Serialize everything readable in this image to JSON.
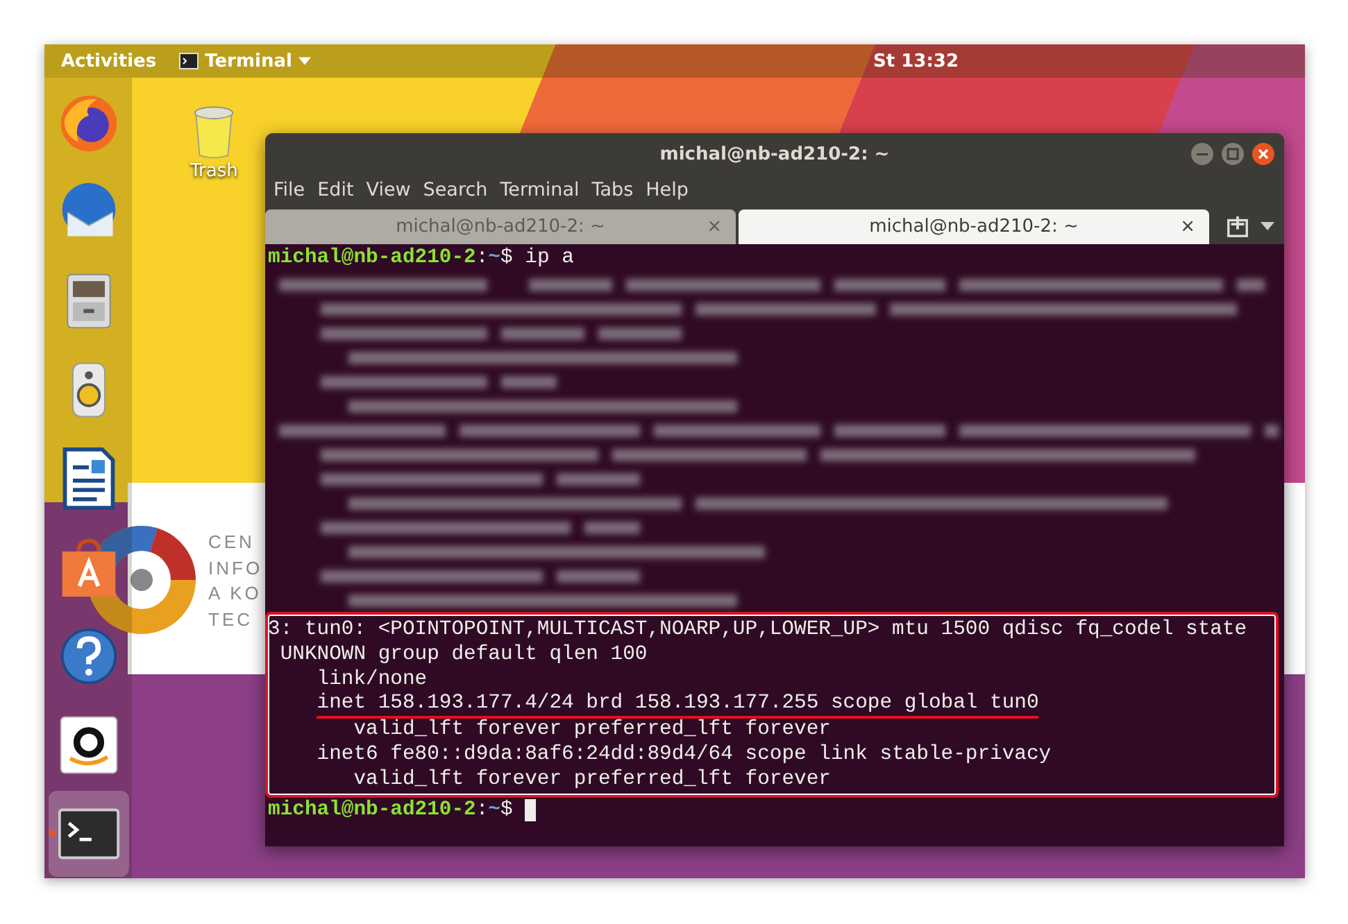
{
  "top_bar": {
    "activities": "Activities",
    "app_menu": "Terminal",
    "clock": "St 13:32"
  },
  "dock": {
    "items": [
      {
        "kind": "firefox",
        "running": false,
        "selected": false
      },
      {
        "kind": "thunderbird",
        "running": false,
        "selected": false
      },
      {
        "kind": "files",
        "running": false,
        "selected": false
      },
      {
        "kind": "speaker",
        "running": false,
        "selected": false
      },
      {
        "kind": "writer",
        "running": false,
        "selected": false
      },
      {
        "kind": "software",
        "running": false,
        "selected": false
      },
      {
        "kind": "help",
        "running": false,
        "selected": false
      },
      {
        "kind": "amazon",
        "running": false,
        "selected": false
      },
      {
        "kind": "terminal",
        "running": true,
        "selected": true
      }
    ]
  },
  "desktop_icons": [
    {
      "label": "Trash"
    }
  ],
  "wallpaper_logo": {
    "lines": [
      "CEN",
      "INFO",
      "A KO",
      "TEC"
    ]
  },
  "window": {
    "title": "michal@nb-ad210-2: ~",
    "menu": [
      "File",
      "Edit",
      "View",
      "Search",
      "Terminal",
      "Tabs",
      "Help"
    ],
    "tabs": [
      {
        "label": "michal@nb-ad210-2: ~",
        "close": "×",
        "selected": false
      },
      {
        "label": "michal@nb-ad210-2: ~",
        "close": "×",
        "selected": true
      }
    ],
    "terminal": {
      "prompt": {
        "user_host": "michal@nb-ad210-2",
        "separator": ":",
        "path": "~",
        "symbol": "$",
        "command": " ip a"
      },
      "highlighted_lines": [
        {
          "text": "3: tun0: <POINTOPOINT,MULTICAST,NOARP,UP,LOWER_UP> mtu 1500 qdisc fq_codel state",
          "underlined": false
        },
        {
          "text": " UNKNOWN group default qlen 100",
          "underlined": false
        },
        {
          "text": "    link/none",
          "underlined": false
        },
        {
          "text": "    inet 158.193.177.4/24 brd 158.193.177.255 scope global tun0",
          "underlined": true
        },
        {
          "text": "       valid_lft forever preferred_lft forever",
          "underlined": false
        },
        {
          "text": "    inet6 fe80::d9da:8af6:24dd:89d4/64 scope link stable-privacy",
          "underlined": false
        },
        {
          "text": "       valid_lft forever preferred_lft forever",
          "underlined": false
        }
      ],
      "final_prompt": {
        "user_host": "michal@nb-ad210-2",
        "separator": ":",
        "path": "~",
        "symbol": "$"
      }
    }
  }
}
